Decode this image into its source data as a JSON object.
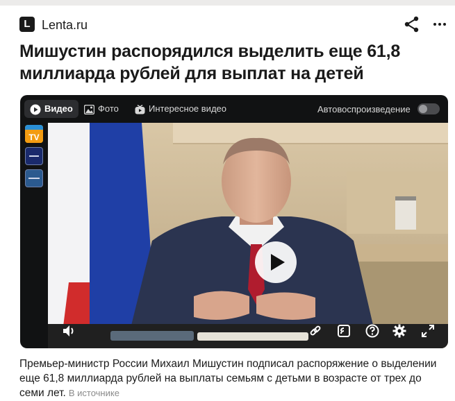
{
  "source": {
    "logo_letter": "L",
    "name": "Lenta.ru"
  },
  "headline": "Мишустин распорядился выделить еще 61,8 миллиарда рублей для выплат на детей",
  "player": {
    "tabs": [
      {
        "label": "Видео",
        "icon": "play-circle-icon",
        "active": true
      },
      {
        "label": "Фото",
        "icon": "image-icon",
        "active": false
      },
      {
        "label": "Интересное видео",
        "icon": "tv-icon",
        "active": false
      }
    ],
    "autoplay_label": "Автовоспроизведение",
    "autoplay_on": false,
    "channel_1_logo": "TV",
    "controls": [
      "volume-icon",
      "link-icon",
      "cast-icon",
      "help-icon",
      "gear-icon",
      "fullscreen-icon"
    ]
  },
  "caption": {
    "text": "Премьер-министр России Михаил Мишустин подписал распоряжение о выделении еще 61,8 миллиарда рублей на выплаты семьям с детьми в возрасте от трех до семи лет.",
    "link": "В источнике"
  }
}
